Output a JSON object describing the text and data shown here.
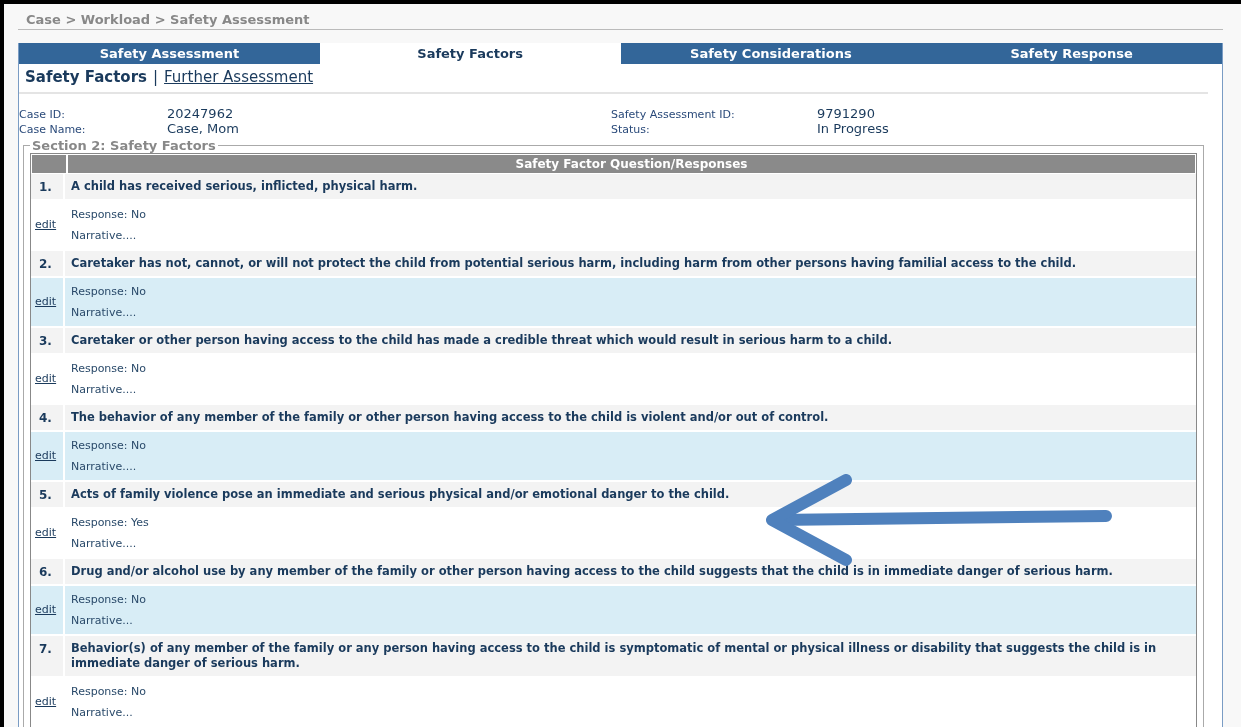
{
  "breadcrumb": "Case > Workload > Safety Assessment",
  "tabs": [
    {
      "label": "Safety Assessment",
      "selected": false
    },
    {
      "label": "Safety Factors",
      "selected": true
    },
    {
      "label": "Safety Considerations",
      "selected": false
    },
    {
      "label": "Safety Response",
      "selected": false
    }
  ],
  "subnav": {
    "current": "Safety Factors",
    "separator": "|",
    "link": "Further Assessment"
  },
  "info": {
    "left": [
      {
        "label": "Case ID:",
        "value": "20247962"
      },
      {
        "label": "Case Name:",
        "value": "Case, Mom"
      }
    ],
    "right": [
      {
        "label": "Safety Assessment ID:",
        "value": "9791290"
      },
      {
        "label": "Status:",
        "value": "In Progress"
      }
    ]
  },
  "section": {
    "title": "Section 2: Safety Factors",
    "table_header": "Safety Factor Question/Responses",
    "rows": [
      {
        "number": "1.",
        "question": "A child has received serious, inflicted, physical harm.",
        "edit": "edit",
        "response": "Response: No",
        "narrative": "Narrative...."
      },
      {
        "number": "2.",
        "question": "Caretaker has not, cannot, or will not protect the child from potential serious harm, including harm from other persons having familial access to the child.",
        "edit": "edit",
        "response": "Response: No",
        "narrative": "Narrative...."
      },
      {
        "number": "3.",
        "question": "Caretaker or other person having access to the child has made a credible threat which would result in serious harm to a child.",
        "edit": "edit",
        "response": "Response: No",
        "narrative": "Narrative...."
      },
      {
        "number": "4.",
        "question": "The behavior of any member of the family or other person having access to the child is violent and/or out of control.",
        "edit": "edit",
        "response": "Response: No",
        "narrative": "Narrative...."
      },
      {
        "number": "5.",
        "question": "Acts of family violence pose an immediate and serious physical and/or emotional danger to the child.",
        "edit": "edit",
        "response": "Response: Yes",
        "narrative": "Narrative...."
      },
      {
        "number": "6.",
        "question": "Drug and/or alcohol use by any member of the family or other person having access to the child suggests that the child is in immediate danger of serious harm.",
        "edit": "edit",
        "response": "Response: No",
        "narrative": "Narrative..."
      },
      {
        "number": "7.",
        "question": "Behavior(s) of any member of the family or any person having access to the child is symptomatic of mental or physical illness or disability that suggests the child is in immediate danger of serious harm.",
        "edit": "edit",
        "response": "Response: No",
        "narrative": "Narrative..."
      }
    ]
  }
}
